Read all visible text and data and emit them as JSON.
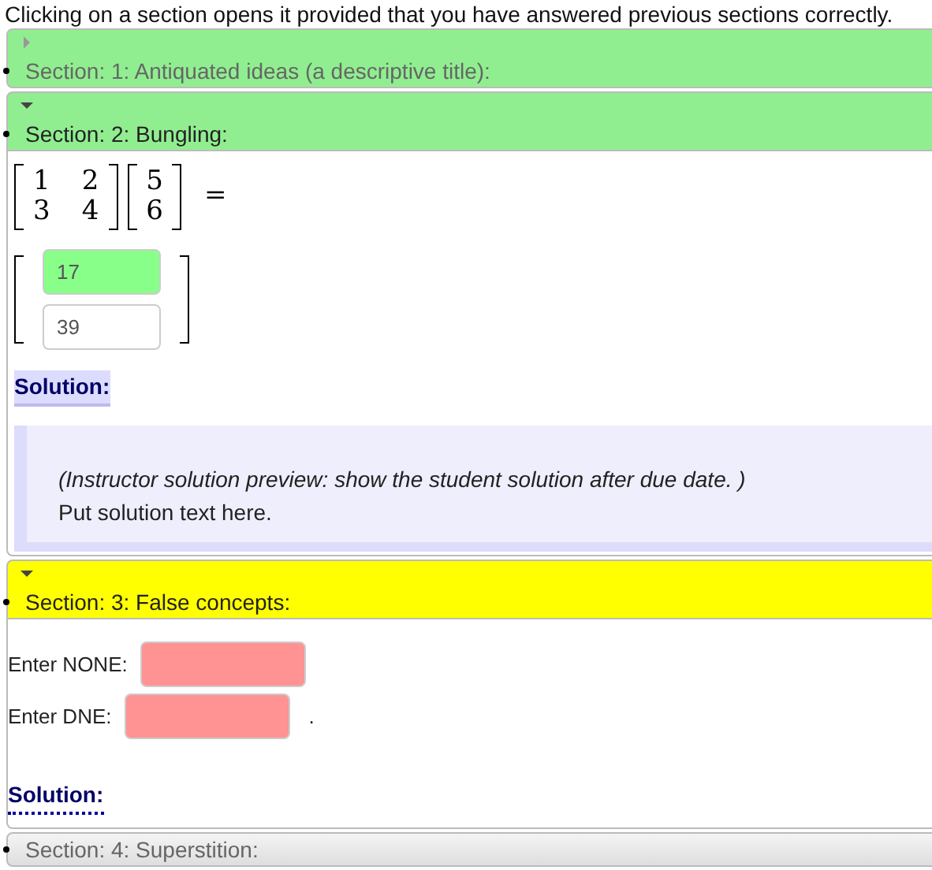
{
  "instructions": "Clicking on a section opens it provided that you have answered previous sections correctly.",
  "sections": [
    {
      "title": "Section: 1: Antiquated ideas (a descriptive title):",
      "color": "#90ee90",
      "locked": false,
      "expanded": false
    },
    {
      "title": "Section: 2: Bungling:",
      "color": "#90ee90",
      "locked": false,
      "expanded": true,
      "body": {
        "kind": "matrix",
        "matrix": [
          [
            "1",
            "2"
          ],
          [
            "3",
            "4"
          ]
        ],
        "vector": [
          "5",
          "6"
        ],
        "equals": "=",
        "answers": [
          {
            "value": "17",
            "graded": true,
            "correct": true
          },
          {
            "value": "39",
            "graded": false
          }
        ],
        "solution": {
          "label": "Solution:",
          "expanded": true,
          "note": "(Instructor solution preview: show the student solution after due date. )",
          "text": "Put solution text here."
        }
      }
    },
    {
      "title": "Section: 3: False concepts:",
      "color": "#ffff00",
      "locked": false,
      "expanded": true,
      "body": {
        "kind": "fields",
        "fields": [
          {
            "label": "Enter NONE:",
            "graded": true,
            "correct": false
          },
          {
            "label": "Enter DNE:",
            "graded": true,
            "correct": false,
            "suffix": "."
          }
        ],
        "solution": {
          "label": "Solution:",
          "expanded": false
        }
      }
    },
    {
      "title": "Section: 4: Superstition:",
      "locked": true,
      "expanded": false
    }
  ]
}
